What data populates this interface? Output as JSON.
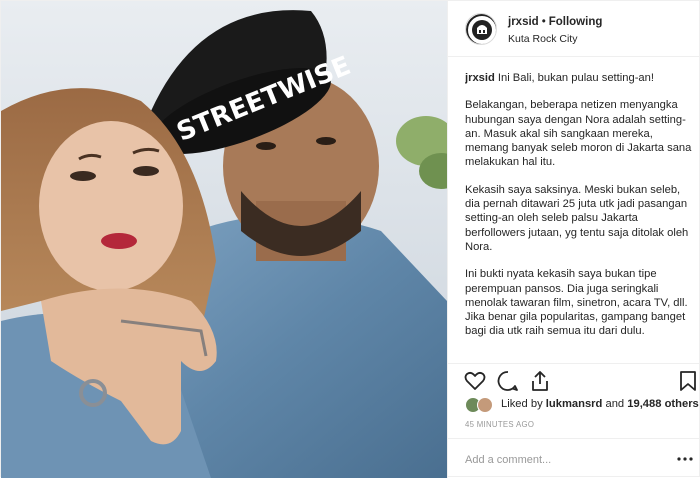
{
  "header": {
    "username": "jrxsid",
    "separator": "•",
    "follow_status": "Following",
    "location": "Kuta Rock City",
    "avatar_icon": "rock-emblem-avatar"
  },
  "photo": {
    "cap_text": "STREETWISE",
    "description_icon": "couple-selfie-photo"
  },
  "caption": {
    "username": "jrxsid",
    "lead": "Ini Bali, bukan pulau setting-an!",
    "paragraphs": [
      "Belakangan, beberapa netizen menyangka hubungan saya dengan Nora adalah setting-an. Masuk akal sih sangkaan mereka, memang banyak seleb moron di Jakarta sana melakukan hal itu.",
      "Kekasih saya saksinya. Meski bukan seleb, dia pernah ditawari 25 juta utk jadi pasangan setting-an oleh seleb palsu Jakarta berfollowers jutaan, yg tentu saja ditolak oleh Nora.",
      "Ini bukti nyata kekasih saya bukan tipe perempuan pansos. Dia juga seringkali menolak tawaran film, sinetron, acara TV, dll. Jika benar gila popularitas, gampang banget bagi dia utk raih semua itu dari dulu."
    ]
  },
  "actions": {
    "like_icon": "heart-icon",
    "comment_icon": "comment-icon",
    "share_icon": "share-icon",
    "save_icon": "bookmark-icon"
  },
  "likes": {
    "prefix": "Liked by",
    "liked_user": "lukmansrd",
    "middle": "and",
    "count": "19,488 others"
  },
  "timestamp": "45 MINUTES AGO",
  "comment": {
    "placeholder": "Add a comment...",
    "more_icon": "more-options-icon"
  },
  "colors": {
    "text": "#262626",
    "muted": "#999999",
    "border": "#efefef"
  }
}
